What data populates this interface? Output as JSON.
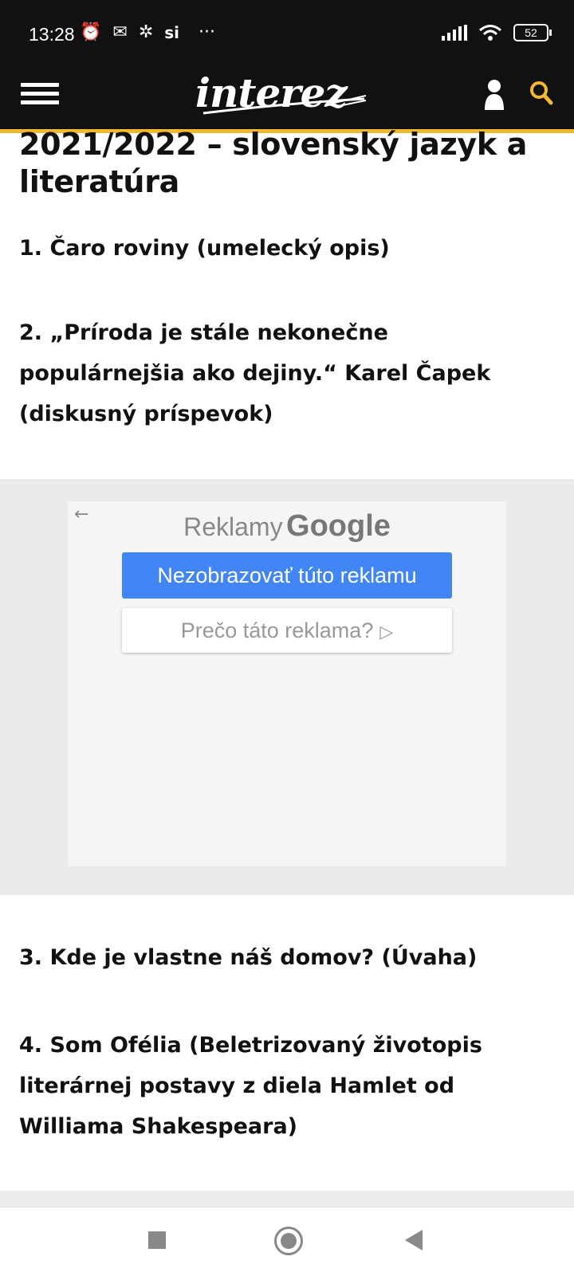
{
  "status": {
    "time": "13:28",
    "battery": "52"
  },
  "header": {
    "logo_text": "interez"
  },
  "article": {
    "title": "2021/2022 – slovenský jazyk a literatúra",
    "items": [
      "1.  Čaro roviny (umelecký opis)",
      "2. „Príroda je stále nekonečne populárnejšia ako dejiny.“ Karel Čapek (diskusný príspevok)",
      "3. Kde je vlastne náš domov? (Úvaha)",
      "4. Som Ofélia (Beletrizovaný životopis literárnej postavy z diela Hamlet od Williama Shakespeara)"
    ]
  },
  "ad": {
    "title_prefix": "Reklamy",
    "title_brand": "Google",
    "primary_button": "Nezobrazovať túto reklamu",
    "secondary_button": "Prečo táto reklama?",
    "accent_color": "#4285f4"
  },
  "colors": {
    "header_bg": "#111111",
    "accent": "#f2b830"
  }
}
